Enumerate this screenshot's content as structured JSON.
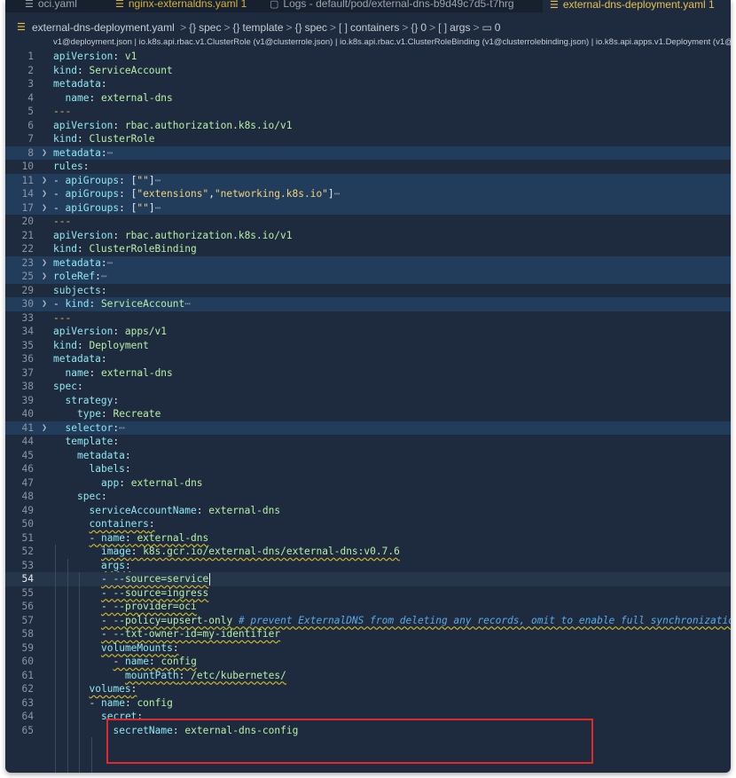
{
  "tabs": [
    {
      "label": "oci.yaml",
      "style": "plain"
    },
    {
      "label": "nginx-externaldns.yaml 1",
      "style": "yellow"
    },
    {
      "label": "Logs - default/pod/external-dns-b9d49c7d5-t7hrg",
      "style": "plain"
    },
    {
      "label": "external-dns-deployment.yaml 1",
      "style": "active"
    }
  ],
  "breadcrumb": {
    "file": "external-dns-deployment.yaml",
    "segments": [
      {
        "sym": "{}",
        "label": "spec"
      },
      {
        "sym": "{}",
        "label": "template"
      },
      {
        "sym": "{}",
        "label": "spec"
      },
      {
        "sym": "[ ]",
        "label": "containers"
      },
      {
        "sym": "{}",
        "label": "0"
      },
      {
        "sym": "[ ]",
        "label": "args"
      },
      {
        "sym": "▭",
        "label": "0"
      }
    ]
  },
  "schema_bar": "v1@deployment.json | io.k8s.api.rbac.v1.ClusterRole (v1@clusterrole.json) | io.k8s.api.rbac.v1.ClusterRoleBinding (v1@clusterrolebinding.json) | io.k8s.api.apps.v1.Deployment (v1@deploymen",
  "colors": {
    "editor_bg": "#1e2b3e",
    "key": "#8ee8f2",
    "value": "#b7f0a5",
    "comment": "#5aa9e6",
    "squiggle": "#d4b82a",
    "highlight_box": "#e02a2a"
  },
  "lines": [
    {
      "n": "1",
      "indent": 0,
      "key": "apiVersion",
      "val": "v1"
    },
    {
      "n": "2",
      "indent": 0,
      "key": "kind",
      "val": "ServiceAccount"
    },
    {
      "n": "3",
      "indent": 0,
      "key": "metadata"
    },
    {
      "n": "4",
      "indent": 1,
      "key": "name",
      "val": "external-dns"
    },
    {
      "n": "5",
      "indent": 0,
      "sep": "---"
    },
    {
      "n": "6",
      "indent": 0,
      "key": "apiVersion",
      "val": "rbac.authorization.k8s.io/v1"
    },
    {
      "n": "7",
      "indent": 0,
      "key": "kind",
      "val": "ClusterRole"
    },
    {
      "n": "8",
      "indent": 0,
      "key": "metadata",
      "folded": true
    },
    {
      "n": "10",
      "indent": 0,
      "key": "rules"
    },
    {
      "n": "11",
      "indent": 0,
      "dash": true,
      "key": "apiGroups",
      "rawval": "[\"\"]",
      "folded": true
    },
    {
      "n": "14",
      "indent": 0,
      "dash": true,
      "key": "apiGroups",
      "rawval": "[\"extensions\",\"networking.k8s.io\"]",
      "folded": true
    },
    {
      "n": "17",
      "indent": 0,
      "dash": true,
      "key": "apiGroups",
      "rawval": "[\"\"]",
      "folded": true
    },
    {
      "n": "20",
      "indent": 0,
      "sep": "---"
    },
    {
      "n": "21",
      "indent": 0,
      "key": "apiVersion",
      "val": "rbac.authorization.k8s.io/v1"
    },
    {
      "n": "22",
      "indent": 0,
      "key": "kind",
      "val": "ClusterRoleBinding"
    },
    {
      "n": "23",
      "indent": 0,
      "key": "metadata",
      "folded": true
    },
    {
      "n": "25",
      "indent": 0,
      "key": "roleRef",
      "folded": true
    },
    {
      "n": "29",
      "indent": 0,
      "key": "subjects"
    },
    {
      "n": "30",
      "indent": 0,
      "dash": true,
      "key": "kind",
      "val": "ServiceAccount",
      "folded": true
    },
    {
      "n": "33",
      "indent": 0,
      "sep": "---"
    },
    {
      "n": "34",
      "indent": 0,
      "key": "apiVersion",
      "val": "apps/v1"
    },
    {
      "n": "35",
      "indent": 0,
      "key": "kind",
      "val": "Deployment"
    },
    {
      "n": "36",
      "indent": 0,
      "key": "metadata"
    },
    {
      "n": "37",
      "indent": 1,
      "key": "name",
      "val": "external-dns"
    },
    {
      "n": "38",
      "indent": 0,
      "key": "spec"
    },
    {
      "n": "39",
      "indent": 1,
      "key": "strategy"
    },
    {
      "n": "40",
      "indent": 2,
      "key": "type",
      "val": "Recreate"
    },
    {
      "n": "41",
      "indent": 1,
      "key": "selector",
      "folded": true
    },
    {
      "n": "44",
      "indent": 1,
      "key": "template"
    },
    {
      "n": "45",
      "indent": 2,
      "key": "metadata"
    },
    {
      "n": "46",
      "indent": 3,
      "key": "labels"
    },
    {
      "n": "47",
      "indent": 4,
      "key": "app",
      "val": "external-dns"
    },
    {
      "n": "48",
      "indent": 2,
      "key": "spec"
    },
    {
      "n": "49",
      "indent": 3,
      "key": "serviceAccountName",
      "val": "external-dns"
    },
    {
      "n": "50",
      "indent": 3,
      "key": "containers",
      "sq": true
    },
    {
      "n": "51",
      "indent": 3,
      "dash": true,
      "key": "name",
      "val": "external-dns",
      "sq": true
    },
    {
      "n": "52",
      "indent": 4,
      "key": "image",
      "val": "k8s.gcr.io/external-dns/external-dns:v0.7.6",
      "sq": true
    },
    {
      "n": "53",
      "indent": 4,
      "key": "args",
      "sq": true
    },
    {
      "n": "54",
      "indent": 4,
      "dash": true,
      "val": "--source=service",
      "sq": true,
      "current": true
    },
    {
      "n": "55",
      "indent": 4,
      "dash": true,
      "val": "--source=ingress",
      "sq": true
    },
    {
      "n": "56",
      "indent": 4,
      "dash": true,
      "val": "--provider=oci",
      "sq": true
    },
    {
      "n": "57",
      "indent": 4,
      "dash": true,
      "val": "--policy=upsert-only",
      "comment": "# prevent ExternalDNS from deleting any records, omit to enable full synchronization",
      "sq": true
    },
    {
      "n": "58",
      "indent": 4,
      "dash": true,
      "val": "--txt-owner-id=my-identifier",
      "sq": true
    },
    {
      "n": "59",
      "indent": 4,
      "key": "volumeMounts",
      "sq": true
    },
    {
      "n": "60",
      "indent": 5,
      "dash": true,
      "key": "name",
      "val": "config",
      "sq": true
    },
    {
      "n": "61",
      "indent": 6,
      "key": "mountPath",
      "val": "/etc/kubernetes/",
      "sq": true
    },
    {
      "n": "62",
      "indent": 3,
      "key": "volumes",
      "sq": true
    },
    {
      "n": "63",
      "indent": 3,
      "dash": true,
      "key": "name",
      "val": "config"
    },
    {
      "n": "64",
      "indent": 4,
      "key": "secret"
    },
    {
      "n": "65",
      "indent": 5,
      "key": "secretName",
      "val": "external-dns-config"
    }
  ]
}
